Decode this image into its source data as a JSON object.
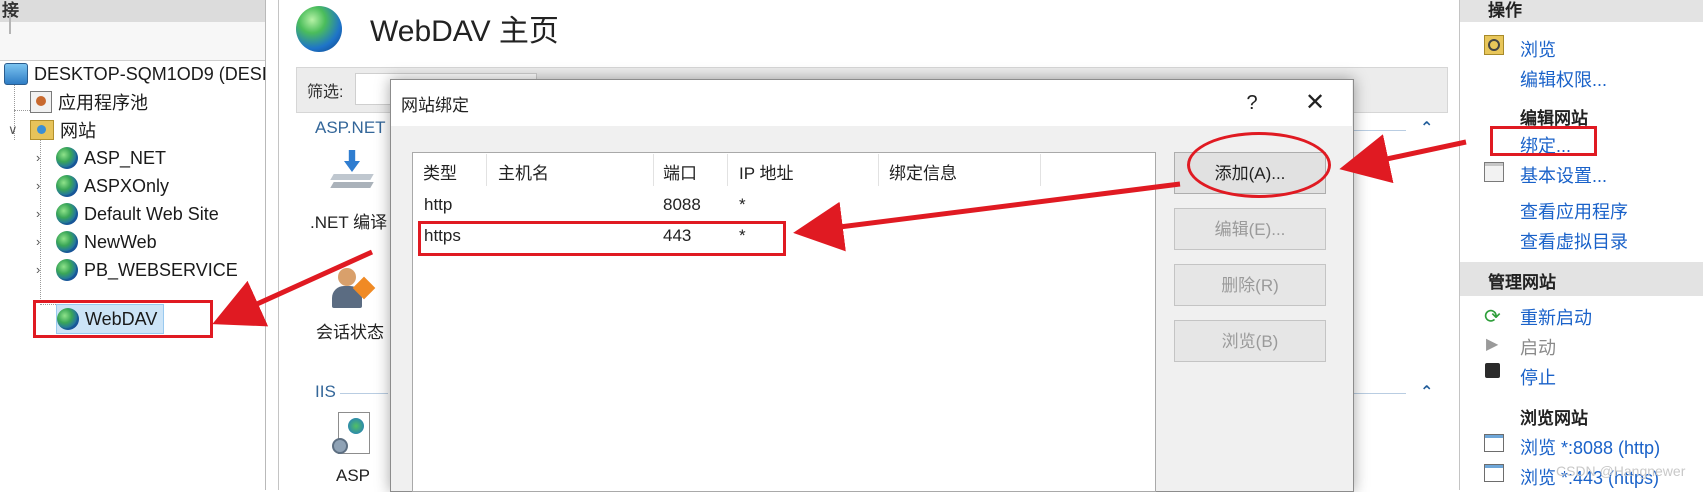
{
  "left": {
    "header": "接",
    "tree": {
      "server": "DESKTOP-SQM1OD9 (DESI",
      "app_pools": "应用程序池",
      "sites": "网站",
      "site_items": [
        "ASP_NET",
        "ASPXOnly",
        "Default Web Site",
        "NewWeb",
        "PB_WEBSERVICE",
        "WebDAV"
      ]
    }
  },
  "main": {
    "title": "WebDAV 主页",
    "filter_label": "筛选:",
    "groups": {
      "aspnet": "ASP.NET",
      "iis": "IIS"
    },
    "features": {
      "net_compile": ".NET 编译",
      "session_state": "会话状态",
      "asp": "ASP"
    }
  },
  "dialog": {
    "title": "网站绑定",
    "help": "?",
    "close": "✕",
    "columns": [
      "类型",
      "主机名",
      "端口",
      "IP 地址",
      "绑定信息"
    ],
    "rows": [
      {
        "type": "http",
        "host": "",
        "port": "8088",
        "ip": "*",
        "info": ""
      },
      {
        "type": "https",
        "host": "",
        "port": "443",
        "ip": "*",
        "info": ""
      }
    ],
    "buttons": {
      "add": "添加(A)...",
      "edit": "编辑(E)...",
      "remove": "删除(R)",
      "browse": "浏览(B)"
    }
  },
  "actions": {
    "header": "操作",
    "explore": "浏览",
    "edit_permissions": "编辑权限...",
    "edit_site_heading": "编辑网站",
    "bindings": "绑定...",
    "basic_settings": "基本设置...",
    "view_apps": "查看应用程序",
    "view_vdirs": "查看虚拟目录",
    "manage_site_heading": "管理网站",
    "restart": "重新启动",
    "start": "启动",
    "stop": "停止",
    "browse_site_heading": "浏览网站",
    "browse_8088": "浏览 *:8088 (http)",
    "browse_443": "浏览 *:443 (https)"
  },
  "watermark": "CSDN @Hangnewer",
  "colors": {
    "annotation_red": "#e01a22",
    "link_blue": "#1a62c9",
    "group_blue": "#336699"
  }
}
